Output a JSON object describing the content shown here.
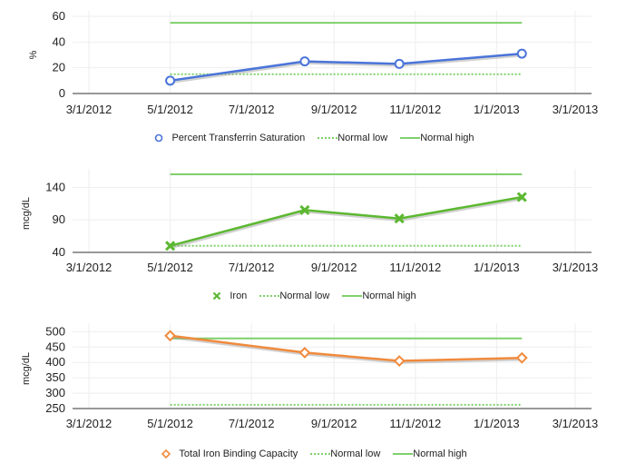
{
  "chart_data": [
    {
      "type": "line",
      "ylabel": "%",
      "ylim": [
        0,
        60
      ],
      "yticks": [
        0,
        20,
        40,
        60
      ],
      "xlim": [
        "2012-03-01",
        "2013-03-01"
      ],
      "xtick_labels": [
        "3/1/2012",
        "5/1/2012",
        "7/1/2012",
        "9/1/2012",
        "11/1/2012",
        "1/1/2013",
        "3/1/2013"
      ],
      "grid": true,
      "legend_position": "bottom",
      "series": [
        {
          "name": "Percent Transferrin Saturation",
          "marker": "circle",
          "color": "#4a74d9",
          "points": [
            [
              "2012-05-01",
              10
            ],
            [
              "2012-08-10",
              25
            ],
            [
              "2012-10-20",
              23
            ],
            [
              "2013-01-20",
              31
            ]
          ]
        },
        {
          "name": "Normal low",
          "style": "dotted",
          "color": "#7fd06b",
          "points": [
            [
              "2012-05-01",
              15
            ],
            [
              "2013-01-20",
              15
            ]
          ]
        },
        {
          "name": "Normal high",
          "style": "solid",
          "color": "#7fd06b",
          "points": [
            [
              "2012-05-01",
              55
            ],
            [
              "2013-01-20",
              55
            ]
          ]
        }
      ]
    },
    {
      "type": "line",
      "ylabel": "mcg/dL",
      "ylim": [
        40,
        160
      ],
      "yticks": [
        40,
        90,
        140
      ],
      "xlim": [
        "2012-03-01",
        "2013-03-01"
      ],
      "xtick_labels": [
        "3/1/2012",
        "5/1/2012",
        "7/1/2012",
        "9/1/2012",
        "11/1/2012",
        "1/1/2013",
        "3/1/2013"
      ],
      "grid": true,
      "legend_position": "bottom",
      "series": [
        {
          "name": "Iron",
          "marker": "x",
          "color": "#5cb831",
          "points": [
            [
              "2012-05-01",
              50
            ],
            [
              "2012-08-10",
              105
            ],
            [
              "2012-10-20",
              92
            ],
            [
              "2013-01-20",
              125
            ]
          ]
        },
        {
          "name": "Normal low",
          "style": "dotted",
          "color": "#7fd06b",
          "points": [
            [
              "2012-05-01",
              50
            ],
            [
              "2013-01-20",
              50
            ]
          ]
        },
        {
          "name": "Normal high",
          "style": "solid",
          "color": "#7fd06b",
          "points": [
            [
              "2012-05-01",
              160
            ],
            [
              "2013-01-20",
              160
            ]
          ]
        }
      ]
    },
    {
      "type": "line",
      "ylabel": "mcg/dL",
      "ylim": [
        250,
        510
      ],
      "yticks": [
        250,
        300,
        350,
        400,
        450,
        500
      ],
      "xlim": [
        "2012-03-01",
        "2013-03-01"
      ],
      "xtick_labels": [
        "3/1/2012",
        "5/1/2012",
        "7/1/2012",
        "9/1/2012",
        "11/1/2012",
        "1/1/2013",
        "3/1/2013"
      ],
      "grid": true,
      "legend_position": "bottom",
      "series": [
        {
          "name": "Total Iron Binding Capacity",
          "marker": "diamond",
          "color": "#f08a3c",
          "points": [
            [
              "2012-05-01",
              487
            ],
            [
              "2012-08-10",
              432
            ],
            [
              "2012-10-20",
              405
            ],
            [
              "2013-01-20",
              415
            ]
          ]
        },
        {
          "name": "Normal low",
          "style": "dotted",
          "color": "#7fd06b",
          "points": [
            [
              "2012-05-01",
              262
            ],
            [
              "2013-01-20",
              262
            ]
          ]
        },
        {
          "name": "Normal high",
          "style": "solid",
          "color": "#7fd06b",
          "points": [
            [
              "2012-05-01",
              478
            ],
            [
              "2013-01-20",
              478
            ]
          ]
        }
      ]
    }
  ]
}
